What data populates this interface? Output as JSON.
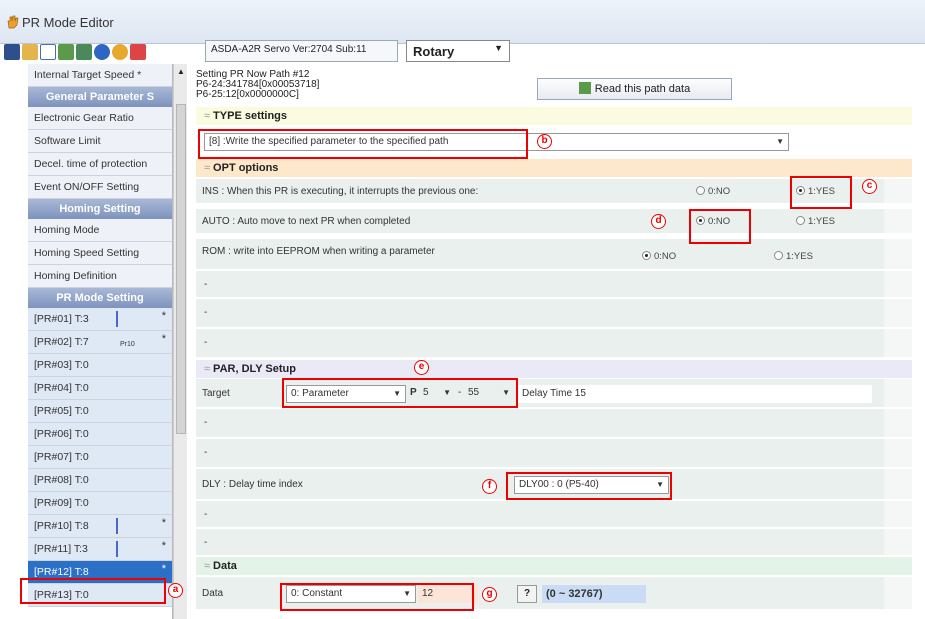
{
  "window": {
    "title": "PR Mode Editor"
  },
  "toolbar": {
    "icons": [
      "save-icon",
      "open-icon",
      "new-file-icon",
      "upload-icon",
      "download-icon",
      "help-icon",
      "info-icon",
      "close-icon"
    ],
    "version": "ASDA-A2R Servo Ver:2704 Sub:11",
    "mode_select": "Rotary"
  },
  "sidebar": {
    "items": [
      {
        "label": "Internal Target Speed  *",
        "kind": "item"
      },
      {
        "label": "General Parameter S",
        "kind": "head"
      },
      {
        "label": "Electronic Gear Ratio",
        "kind": "item"
      },
      {
        "label": "Software Limit",
        "kind": "item"
      },
      {
        "label": "Decel. time of protection",
        "kind": "item"
      },
      {
        "label": "Event ON/OFF Setting",
        "kind": "item"
      },
      {
        "label": "Homing Setting",
        "kind": "head"
      },
      {
        "label": "Homing Mode",
        "kind": "item"
      },
      {
        "label": "Homing Speed Setting",
        "kind": "item"
      },
      {
        "label": "Homing Definition",
        "kind": "item"
      },
      {
        "label": "PR Mode Setting",
        "kind": "head"
      }
    ],
    "pr_items": [
      {
        "label": "[PR#01]  T:3",
        "star": "*",
        "sub": ""
      },
      {
        "label": "[PR#02]  T:7",
        "star": "*",
        "sub": "Pr10"
      },
      {
        "label": "[PR#03]  T:0",
        "star": "",
        "sub": ""
      },
      {
        "label": "[PR#04]  T:0",
        "star": "",
        "sub": ""
      },
      {
        "label": "[PR#05]  T:0",
        "star": "",
        "sub": ""
      },
      {
        "label": "[PR#06]  T:0",
        "star": "",
        "sub": ""
      },
      {
        "label": "[PR#07]  T:0",
        "star": "",
        "sub": ""
      },
      {
        "label": "[PR#08]  T:0",
        "star": "",
        "sub": ""
      },
      {
        "label": "[PR#09]  T:0",
        "star": "",
        "sub": ""
      },
      {
        "label": "[PR#10]  T:8",
        "star": "*",
        "sub": ""
      },
      {
        "label": "[PR#11]  T:3",
        "star": "*",
        "sub": ""
      },
      {
        "label": "[PR#12]  T:8",
        "star": "*",
        "sub": ""
      },
      {
        "label": "[PR#13]  T:0",
        "star": "",
        "sub": ""
      }
    ]
  },
  "header": {
    "line1": "Setting PR Now Path #12",
    "line2": "P6-24:341784[0x00053718]",
    "line3": "P6-25:12[0x0000000C]",
    "read_button": "Read this path data"
  },
  "type_section": {
    "title": "TYPE settings",
    "select": "[8] :Write the specified parameter to the specified path"
  },
  "opt_section": {
    "title": "OPT options",
    "rows": [
      {
        "label": "INS : When this PR is executing, it interrupts the previous one:",
        "no": "0:NO",
        "yes": "1:YES",
        "selected": "yes"
      },
      {
        "label": "AUTO : Auto move to next PR when completed",
        "no": "0:NO",
        "yes": "1:YES",
        "selected": "no"
      },
      {
        "label": "ROM : write into EEPROM when writing a parameter",
        "no": "0:NO",
        "yes": "1:YES",
        "selected": "no"
      }
    ],
    "dash": "-"
  },
  "par_section": {
    "title": "PAR, DLY Setup",
    "target_label": "Target",
    "target_select": "0: Parameter",
    "p_label": "P",
    "p_group": "5",
    "p_index": "55",
    "delay_text": "Delay Time 15",
    "dly_label": "DLY : Delay time index",
    "dly_select": "DLY00 : 0 (P5-40)",
    "dash": "-"
  },
  "data_section": {
    "title": "Data",
    "label": "Data",
    "select": "0: Constant",
    "value": "12",
    "help": "?",
    "range": "(0 ~ 32767)"
  },
  "annotations": {
    "a": "a",
    "b": "b",
    "c": "c",
    "d": "d",
    "e": "e",
    "f": "f",
    "g": "g"
  },
  "colors": {
    "selected_item": "#2b6fc6",
    "highlight": "#ee0000"
  }
}
